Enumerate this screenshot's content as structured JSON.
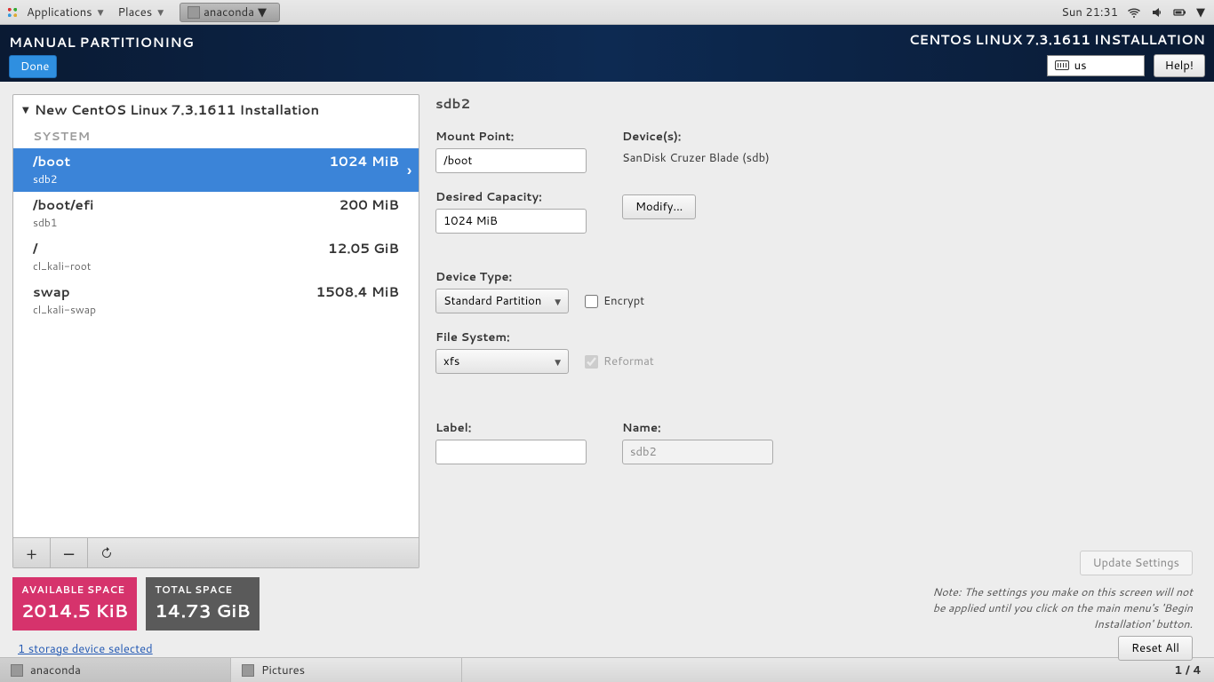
{
  "panel": {
    "applications": "Applications",
    "places": "Places",
    "active_app": "anaconda",
    "clock": "Sun 21:31"
  },
  "header": {
    "title": "MANUAL PARTITIONING",
    "done": "Done",
    "install_title": "CENTOS LINUX 7.3.1611 INSTALLATION",
    "kb_layout": "us",
    "help": "Help!"
  },
  "tree": {
    "root_label": "New CentOS Linux 7.3.1611 Installation",
    "section": "SYSTEM",
    "partitions": [
      {
        "mount": "/boot",
        "size": "1024 MiB",
        "dev": "sdb2",
        "selected": true
      },
      {
        "mount": "/boot/efi",
        "size": "200 MiB",
        "dev": "sdb1",
        "selected": false
      },
      {
        "mount": "/",
        "size": "12.05 GiB",
        "dev": "cl_kali-root",
        "selected": false
      },
      {
        "mount": "swap",
        "size": "1508.4 MiB",
        "dev": "cl_kali-swap",
        "selected": false
      }
    ]
  },
  "space": {
    "avail_label": "AVAILABLE SPACE",
    "avail_value": "2014.5 KiB",
    "total_label": "TOTAL SPACE",
    "total_value": "14.73 GiB"
  },
  "storage_link": "1 storage device selected",
  "detail": {
    "title": "sdb2",
    "mount_label": "Mount Point:",
    "mount_value": "/boot",
    "capacity_label": "Desired Capacity:",
    "capacity_value": "1024 MiB",
    "devices_label": "Device(s):",
    "devices_value": "SanDisk Cruzer Blade (sdb)",
    "modify": "Modify...",
    "devtype_label": "Device Type:",
    "devtype_value": "Standard Partition",
    "encrypt": "Encrypt",
    "fs_label": "File System:",
    "fs_value": "xfs",
    "reformat": "Reformat",
    "label_label": "Label:",
    "label_value": "",
    "name_label": "Name:",
    "name_value": "sdb2",
    "update": "Update Settings",
    "note": "Note:   The settings you make on this screen will not be applied until you click on the main menu's 'Begin Installation' button.",
    "reset": "Reset All"
  },
  "taskbar": {
    "t1": "anaconda",
    "t2": "Pictures",
    "ws": "1 / 4"
  }
}
